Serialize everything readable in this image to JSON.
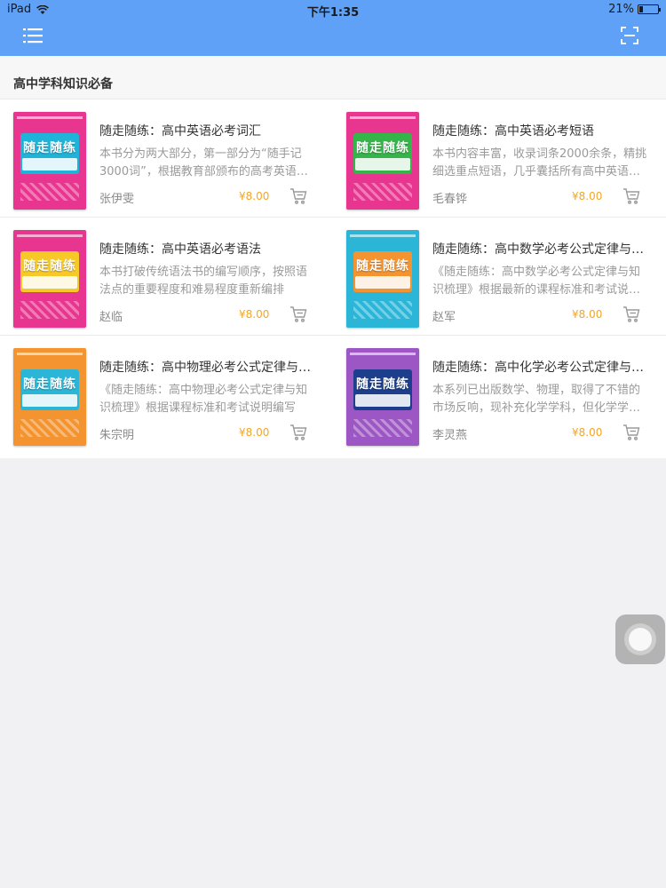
{
  "status_bar": {
    "device": "iPad",
    "time": "下午1:35",
    "battery_percent": "21%",
    "battery_level": 0.21
  },
  "nav": {
    "menu_icon": "list-menu-icon",
    "scan_icon": "scan-icon",
    "bar_color": "#5ea1f6"
  },
  "section": {
    "title": "高中学科知识必备"
  },
  "books": [
    {
      "title": "随走随练：高中英语必考词汇",
      "description": "本书分为两大部分，第一部分为“随手记3000词”，根据教育部颁布的高考英语考试大纲编写",
      "author": "张伊雯",
      "price": "¥8.00",
      "cover_text": "随走随练",
      "cover_color": "#e8358f",
      "band_color": "#1fb3d9"
    },
    {
      "title": "随走随练：高中英语必考短语",
      "description": "本书内容丰富，收录词条2000余条，精挑细选重点短语，几乎囊括所有高中英语短语",
      "author": "毛春铧",
      "price": "¥8.00",
      "cover_text": "随走随练",
      "cover_color": "#e8358f",
      "band_color": "#35b44a"
    },
    {
      "title": "随走随练：高中英语必考语法",
      "description": "本书打破传统语法书的编写顺序，按照语法点的重要程度和难易程度重新编排",
      "author": "赵临",
      "price": "¥8.00",
      "cover_text": "随走随练",
      "cover_color": "#e8358f",
      "band_color": "#f7c928"
    },
    {
      "title": "随走随练：高中数学必考公式定律与知识梳理",
      "description": "《随走随练：高中数学必考公式定律与知识梳理》根据最新的课程标准和考试说明编写",
      "author": "赵军",
      "price": "¥8.00",
      "cover_text": "随走随练",
      "cover_color": "#2bb6d8",
      "band_color": "#f39430"
    },
    {
      "title": "随走随练：高中物理必考公式定律与知识梳理",
      "description": "《随走随练：高中物理必考公式定律与知识梳理》根据课程标准和考试说明编写",
      "author": "朱宗明",
      "price": "¥8.00",
      "cover_text": "随走随练",
      "cover_color": "#f39430",
      "band_color": "#2bb6d8"
    },
    {
      "title": "随走随练：高中化学必考公式定律与知识梳理",
      "description": "本系列已出版数学、物理，取得了不错的市场反响，现补充化学学科，但化学学科特点",
      "author": "李灵燕",
      "price": "¥8.00",
      "cover_text": "随走随练",
      "cover_color": "#9d57c4",
      "band_color": "#1d3e8c"
    }
  ]
}
